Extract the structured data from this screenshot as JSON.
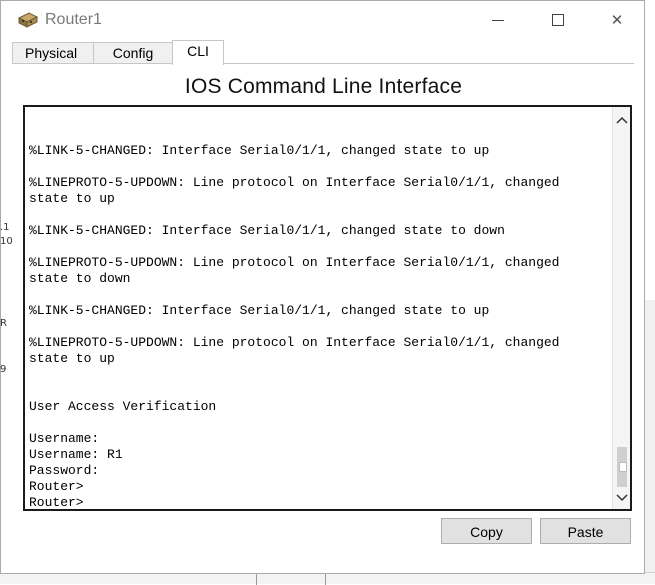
{
  "window": {
    "title": "Router1",
    "controls": {
      "minimize": "minimize",
      "maximize": "maximize",
      "close": "✕"
    }
  },
  "tabs": [
    {
      "label": "Physical",
      "active": false
    },
    {
      "label": "Config",
      "active": false
    },
    {
      "label": "CLI",
      "active": true
    }
  ],
  "cli": {
    "heading": "IOS Command Line Interface",
    "output": [
      "%LINK-5-CHANGED: Interface Serial0/1/1, changed state to up",
      "",
      "%LINEPROTO-5-UPDOWN: Line protocol on Interface Serial0/1/1, changed",
      "state to up",
      "",
      "%LINK-5-CHANGED: Interface Serial0/1/1, changed state to down",
      "",
      "%LINEPROTO-5-UPDOWN: Line protocol on Interface Serial0/1/1, changed",
      "state to down",
      "",
      "%LINK-5-CHANGED: Interface Serial0/1/1, changed state to up",
      "",
      "%LINEPROTO-5-UPDOWN: Line protocol on Interface Serial0/1/1, changed",
      "state to up",
      "",
      "",
      "User Access Verification",
      "",
      "Username: ",
      "Username: R1",
      "Password: ",
      "Router>",
      "Router>"
    ]
  },
  "buttons": {
    "copy": "Copy",
    "paste": "Paste"
  },
  "background_fragments": [
    ".1",
    "10",
    "R",
    "9"
  ],
  "colors": {
    "console_border": "#1a1a1a",
    "button_bg": "#e1e1e1",
    "title_gray": "#7a7a7a"
  }
}
